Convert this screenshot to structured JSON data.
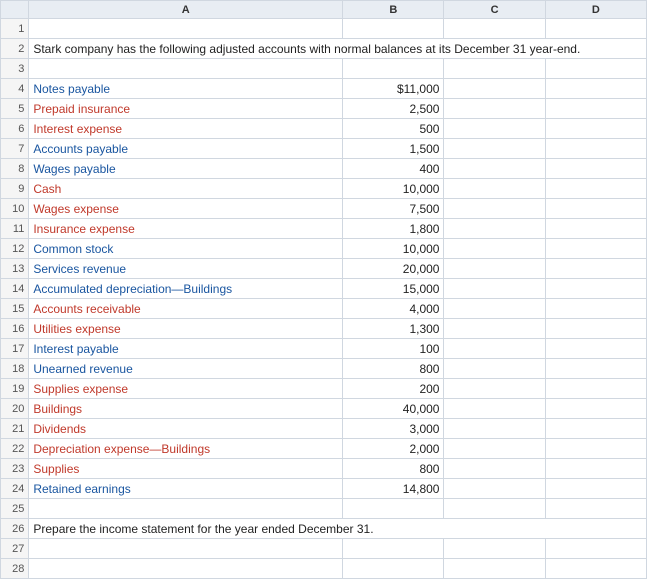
{
  "spreadsheet": {
    "col_headers": [
      "",
      "A",
      "B",
      "C",
      "D"
    ],
    "rows": [
      {
        "num": "1",
        "a": "",
        "b": "",
        "c": "",
        "d": "",
        "type": "empty"
      },
      {
        "num": "2",
        "a": "Stark company has the following adjusted accounts with normal balances at its December 31 year-end.",
        "b": "",
        "c": "",
        "d": "",
        "type": "intro",
        "span": 4
      },
      {
        "num": "3",
        "a": "",
        "b": "",
        "c": "",
        "d": "",
        "type": "empty"
      },
      {
        "num": "4",
        "a": "Notes payable",
        "b": "$11,000",
        "c": "",
        "d": "",
        "type": "data",
        "aclass": "blue-text"
      },
      {
        "num": "5",
        "a": "Prepaid insurance",
        "b": "2,500",
        "c": "",
        "d": "",
        "type": "data",
        "aclass": "red-text"
      },
      {
        "num": "6",
        "a": "Interest expense",
        "b": "500",
        "c": "",
        "d": "",
        "type": "data",
        "aclass": "red-text"
      },
      {
        "num": "7",
        "a": "Accounts payable",
        "b": "1,500",
        "c": "",
        "d": "",
        "type": "data",
        "aclass": "blue-text"
      },
      {
        "num": "8",
        "a": "Wages payable",
        "b": "400",
        "c": "",
        "d": "",
        "type": "data",
        "aclass": "blue-text"
      },
      {
        "num": "9",
        "a": "Cash",
        "b": "10,000",
        "c": "",
        "d": "",
        "type": "data",
        "aclass": "red-text"
      },
      {
        "num": "10",
        "a": "Wages expense",
        "b": "7,500",
        "c": "",
        "d": "",
        "type": "data",
        "aclass": "red-text"
      },
      {
        "num": "11",
        "a": "Insurance expense",
        "b": "1,800",
        "c": "",
        "d": "",
        "type": "data",
        "aclass": "red-text"
      },
      {
        "num": "12",
        "a": "Common stock",
        "b": "10,000",
        "c": "",
        "d": "",
        "type": "data",
        "aclass": "blue-text"
      },
      {
        "num": "13",
        "a": "Services revenue",
        "b": "20,000",
        "c": "",
        "d": "",
        "type": "data",
        "aclass": "blue-text"
      },
      {
        "num": "14",
        "a": "Accumulated depreciation—Buildings",
        "b": "15,000",
        "c": "",
        "d": "",
        "type": "data",
        "aclass": "blue-text"
      },
      {
        "num": "15",
        "a": "Accounts receivable",
        "b": "4,000",
        "c": "",
        "d": "",
        "type": "data",
        "aclass": "red-text"
      },
      {
        "num": "16",
        "a": "Utilities expense",
        "b": "1,300",
        "c": "",
        "d": "",
        "type": "data",
        "aclass": "red-text"
      },
      {
        "num": "17",
        "a": "Interest payable",
        "b": "100",
        "c": "",
        "d": "",
        "type": "data",
        "aclass": "blue-text"
      },
      {
        "num": "18",
        "a": "Unearned revenue",
        "b": "800",
        "c": "",
        "d": "",
        "type": "data",
        "aclass": "blue-text"
      },
      {
        "num": "19",
        "a": "Supplies expense",
        "b": "200",
        "c": "",
        "d": "",
        "type": "data",
        "aclass": "red-text"
      },
      {
        "num": "20",
        "a": "Buildings",
        "b": "40,000",
        "c": "",
        "d": "",
        "type": "data",
        "aclass": "red-text"
      },
      {
        "num": "21",
        "a": "Dividends",
        "b": "3,000",
        "c": "",
        "d": "",
        "type": "data",
        "aclass": "red-text"
      },
      {
        "num": "22",
        "a": "Depreciation expense—Buildings",
        "b": "2,000",
        "c": "",
        "d": "",
        "type": "data",
        "aclass": "red-text"
      },
      {
        "num": "23",
        "a": "Supplies",
        "b": "800",
        "c": "",
        "d": "",
        "type": "data",
        "aclass": "red-text"
      },
      {
        "num": "24",
        "a": "Retained earnings",
        "b": "14,800",
        "c": "",
        "d": "",
        "type": "data",
        "aclass": "blue-text"
      },
      {
        "num": "25",
        "a": "",
        "b": "",
        "c": "",
        "d": "",
        "type": "empty"
      },
      {
        "num": "26",
        "a": "Prepare the income statement for the year ended December 31.",
        "b": "",
        "c": "",
        "d": "",
        "type": "instruction",
        "span": 4
      },
      {
        "num": "27",
        "a": "",
        "b": "",
        "c": "",
        "d": "",
        "type": "empty"
      },
      {
        "num": "28",
        "a": "",
        "b": "",
        "c": "",
        "d": "",
        "type": "empty"
      }
    ]
  }
}
